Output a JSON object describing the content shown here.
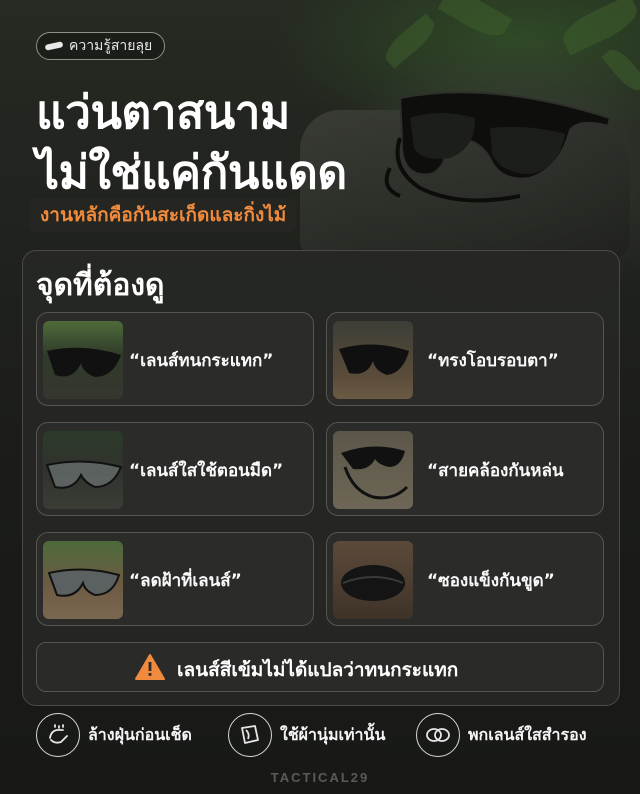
{
  "header": {
    "chip_label": "ความรู้สายลุย",
    "title_line1": "แว่นตาสนาม",
    "title_line2": "ไม่ใช่แค่กันแดด",
    "subtitle": "งานหลักคือกันสะเก็ดและกิ่งไม้"
  },
  "panel": {
    "title": "จุดที่ต้องดู",
    "items": [
      {
        "label": "“เลนส์ทนกระแทก”"
      },
      {
        "label": "“ทรงโอบรอบตา”"
      },
      {
        "label": "“เลนส์ใสใช้ตอนมืด”"
      },
      {
        "label": "“สายคล้องกันหล่น"
      },
      {
        "label": "“ลดฝ้าที่เลนส์”"
      },
      {
        "label": "“ซองแข็งกันขูด”"
      }
    ]
  },
  "warning": {
    "icon": "warning-triangle-icon",
    "text": "เลนส์สีเข้มไม่ได้แปลว่าทนกระแทก"
  },
  "tips": [
    {
      "icon": "wash-hands-icon",
      "label": "ล้างฝุ่นก่อนเช็ด"
    },
    {
      "icon": "soft-cloth-icon",
      "label": "ใช้ผ้านุ่มเท่านั้น"
    },
    {
      "icon": "spare-lens-icon",
      "label": "พกเลนส์ใสสำรอง"
    }
  ],
  "brand": "TACTICAL29",
  "colors": {
    "accent_orange": "#f08a3c",
    "panel_bg": "#262724",
    "card_border": "#55564f"
  }
}
